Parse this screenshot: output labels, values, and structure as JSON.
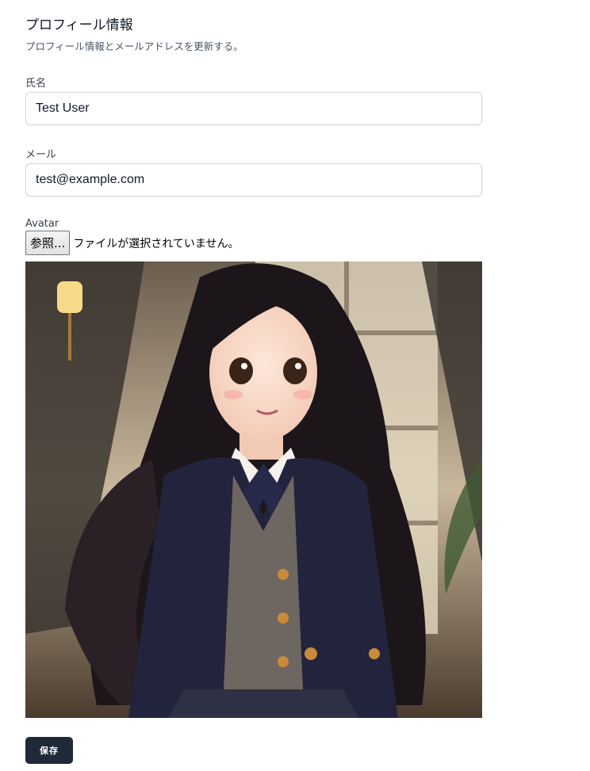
{
  "section": {
    "title": "プロフィール情報",
    "description": "プロフィール情報とメールアドレスを更新する。"
  },
  "fields": {
    "name": {
      "label": "氏名",
      "value": "Test User"
    },
    "email": {
      "label": "メール",
      "value": "test@example.com"
    },
    "avatar": {
      "label": "Avatar",
      "browse_button": "参照...",
      "file_status": "ファイルが選択されていません。",
      "image_subject": "anime-girl-portrait"
    }
  },
  "actions": {
    "save_label": "保存"
  },
  "colors": {
    "save_button_bg": "#1f2937",
    "input_border": "#d1d5db"
  }
}
